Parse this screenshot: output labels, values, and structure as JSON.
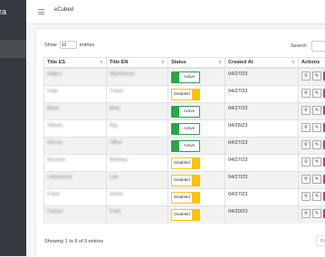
{
  "brand": "ra",
  "app_name": "eCubed",
  "controls": {
    "show_label": "Show",
    "page_size": "10",
    "entries_label": "entries",
    "search_label": "Search:"
  },
  "table": {
    "headers": [
      "Title ES",
      "Title EN",
      "Status",
      "Created At",
      "Actions"
    ],
    "rows": [
      {
        "es": "Hatpro",
        "en": "Warehouse",
        "status": "Active",
        "date": "04/27/23"
      },
      {
        "es": "Viaje",
        "en": "Travel",
        "status": "Disabled",
        "date": "04/27/23"
      },
      {
        "es": "Blaze",
        "en": "Blog",
        "status": "Active",
        "date": "04/27/23"
      },
      {
        "es": "Telsato",
        "en": "Rig",
        "status": "Active",
        "date": "04/26/23"
      },
      {
        "es": "Oficina",
        "en": "Office",
        "status": "Active",
        "date": "04/27/23"
      },
      {
        "es": "Reunion",
        "en": "Meeting",
        "status": "Disabled",
        "date": "04/27/23"
      },
      {
        "es": "Laboratorio",
        "en": "Lab",
        "status": "Disabled",
        "date": "04/27/23"
      },
      {
        "es": "Fotos",
        "en": "Home",
        "status": "Disabled",
        "date": "04/27/23"
      },
      {
        "es": "Campo",
        "en": "Field",
        "status": "Disabled",
        "date": "04/20/23"
      }
    ]
  },
  "footer": {
    "info": "Showing 1 to 9 of 9 entries",
    "prev": "Pr"
  },
  "colors": {
    "sidebar": "#343a40",
    "active": "#28a745",
    "disabled": "#ffc107",
    "danger": "#dc3545"
  },
  "icons": {
    "menu": "hamburger-icon",
    "view": "magnifier-icon",
    "edit": "pencil-icon",
    "delete": "trash-icon"
  }
}
